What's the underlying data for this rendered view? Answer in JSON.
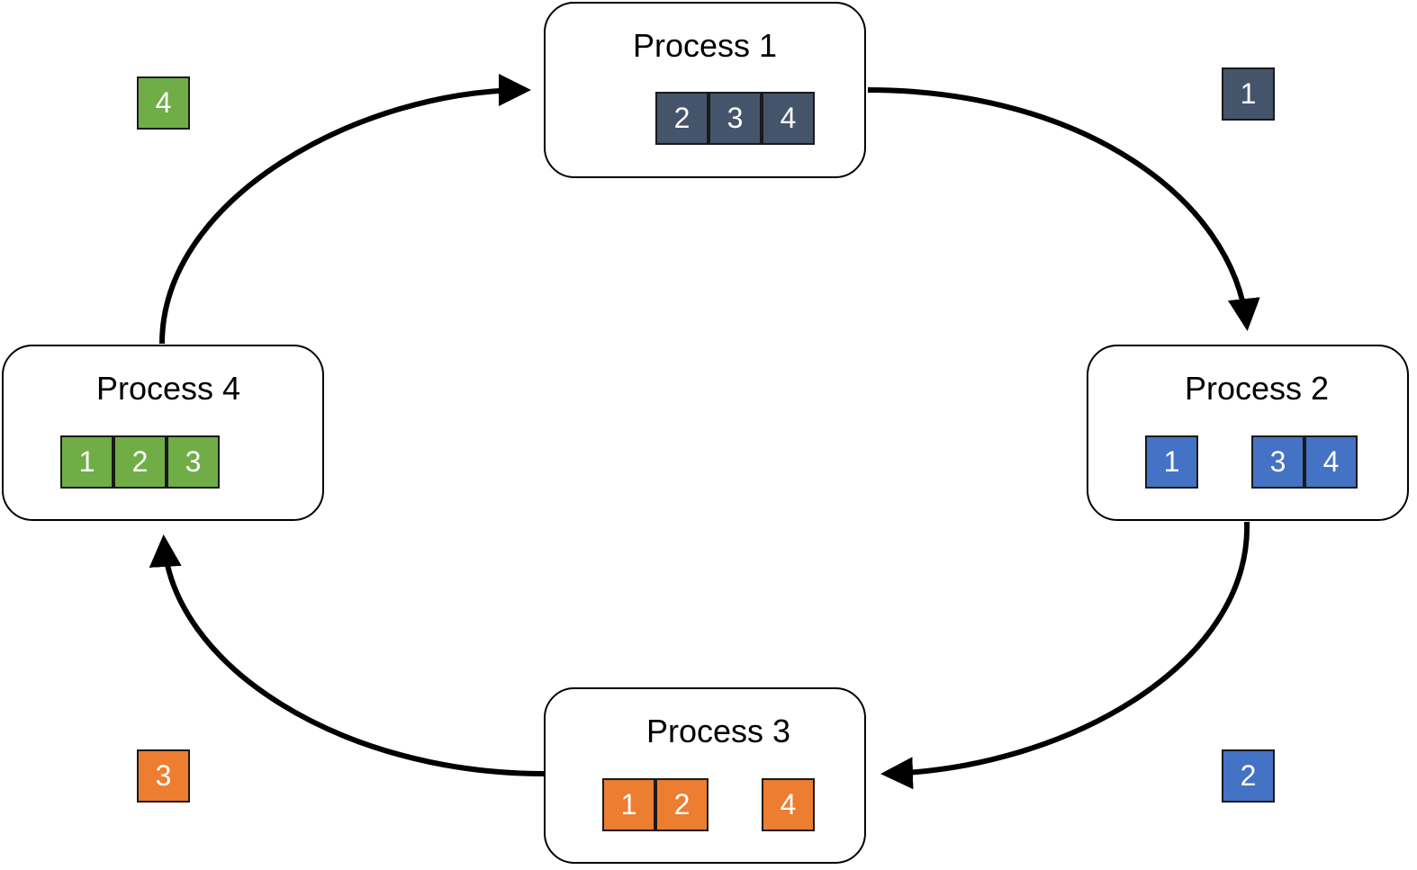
{
  "colors": {
    "process1": "#44546A",
    "process2": "#4472C4",
    "process3": "#ED7D31",
    "process4": "#70AD47"
  },
  "processes": [
    {
      "title": "Process 1",
      "blocks": [
        "2",
        "3",
        "4"
      ]
    },
    {
      "title": "Process 2",
      "blocks": [
        "1",
        "3",
        "4"
      ]
    },
    {
      "title": "Process 3",
      "blocks": [
        "1",
        "2",
        "4"
      ]
    },
    {
      "title": "Process 4",
      "blocks": [
        "1",
        "2",
        "3"
      ]
    }
  ],
  "in_transit": {
    "p1_to_p2": "1",
    "p2_to_p3": "2",
    "p3_to_p4": "3",
    "p4_to_p1": "4"
  }
}
